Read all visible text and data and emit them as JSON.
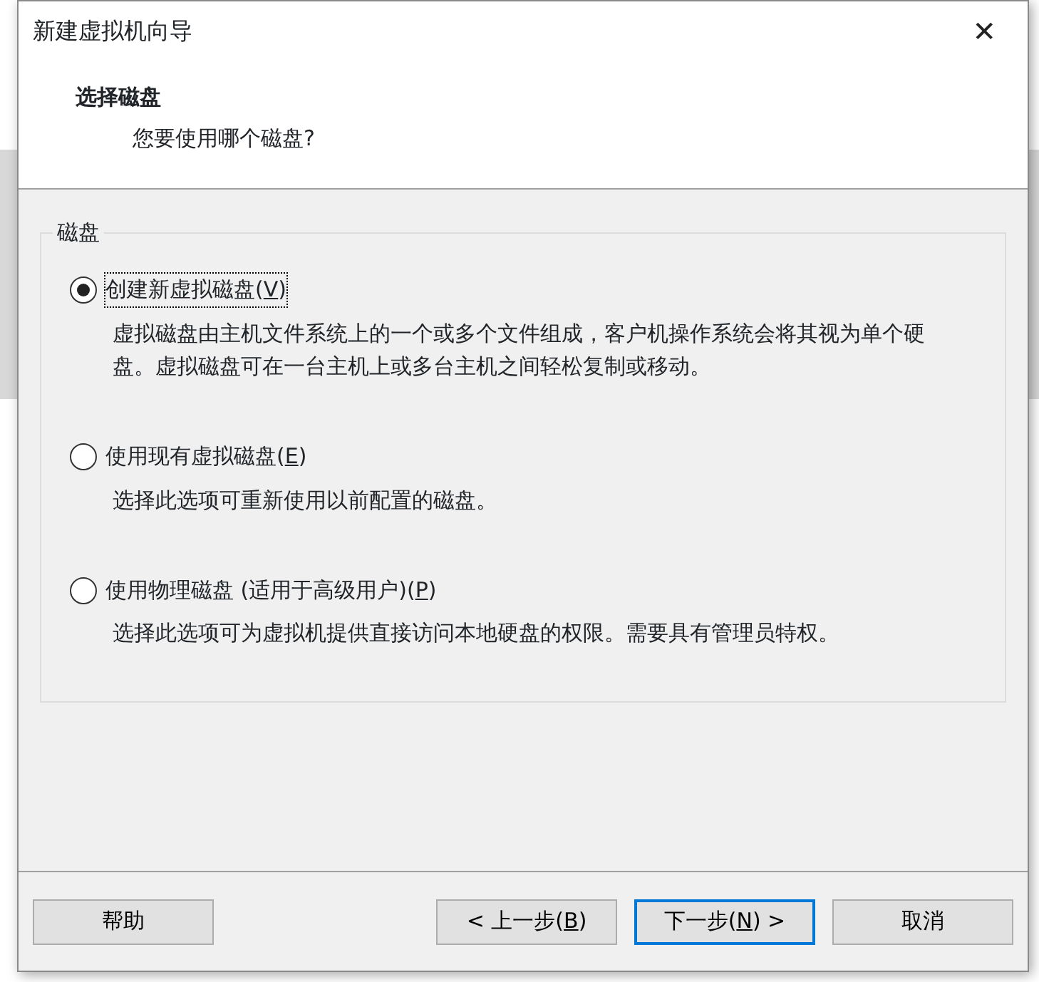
{
  "window": {
    "title": "新建虚拟机向导",
    "close": "✕"
  },
  "header": {
    "title": "选择磁盘",
    "subtitle": "您要使用哪个磁盘?"
  },
  "group": {
    "title": "磁盘",
    "options": [
      {
        "before": "创建新虚拟磁盘(",
        "key": "V",
        "after": ")",
        "selected": true,
        "description": "虚拟磁盘由主机文件系统上的一个或多个文件组成，客户机操作系统会将其视为单个硬盘。虚拟磁盘可在一台主机上或多台主机之间轻松复制或移动。"
      },
      {
        "before": "使用现有虚拟磁盘(",
        "key": "E",
        "after": ")",
        "selected": false,
        "description": "选择此选项可重新使用以前配置的磁盘。"
      },
      {
        "before": "使用物理磁盘 (适用于高级用户)(",
        "key": "P",
        "after": ")",
        "selected": false,
        "description": "选择此选项可为虚拟机提供直接访问本地硬盘的权限。需要具有管理员特权。"
      }
    ]
  },
  "buttons": [
    {
      "before": "帮助",
      "kind": "help",
      "default": false
    },
    {
      "before": "< 上一步(",
      "key": "B",
      "after": ")",
      "kind": "back",
      "default": false
    },
    {
      "before": "下一步(",
      "key": "N",
      "after": ") >",
      "kind": "next",
      "default": true
    },
    {
      "before": "取消",
      "kind": "cancel",
      "default": false
    }
  ]
}
